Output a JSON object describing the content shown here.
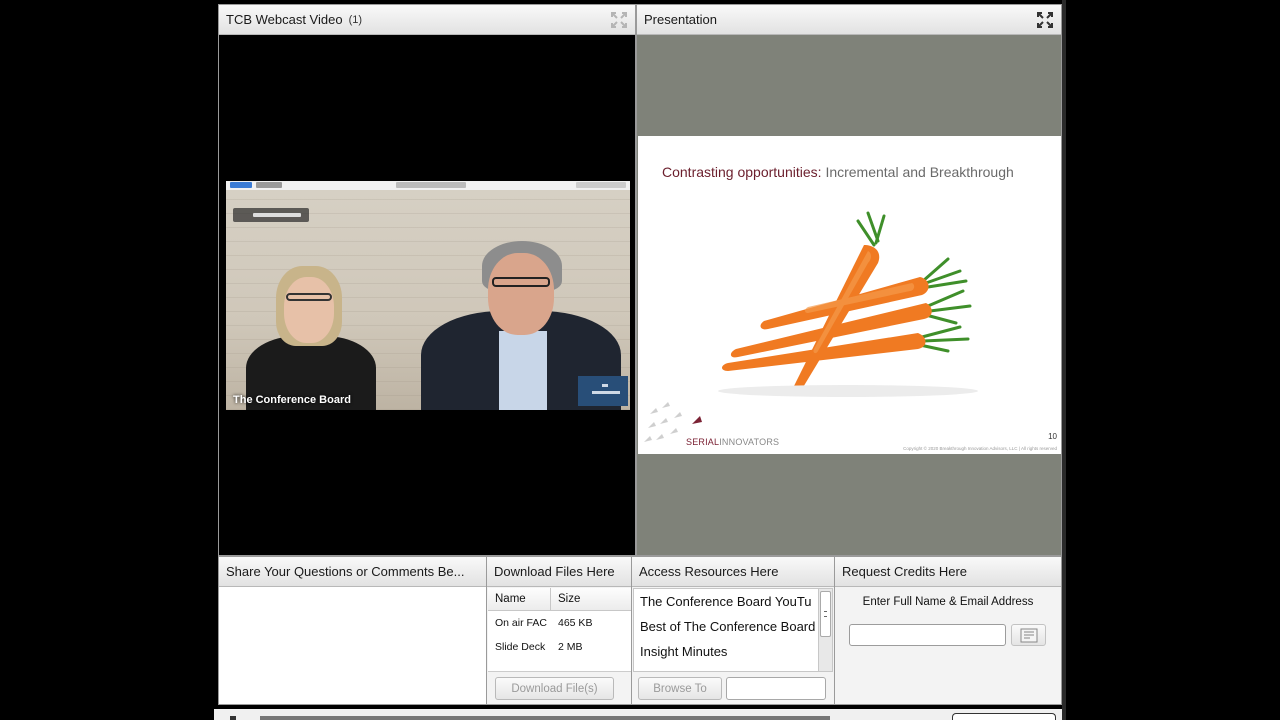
{
  "video_pod": {
    "title": "TCB Webcast Video",
    "count": "(1)",
    "video_label": "The Conference Board"
  },
  "presentation_pod": {
    "title": "Presentation",
    "slide": {
      "title_a": "Contrasting opportunities: ",
      "title_b": "Incremental and Breakthrough",
      "brand_a": "SERIAL",
      "brand_b": "INNOVATORS",
      "number": "10",
      "copyright": "Copyright © 2020 Breakthrough Innovation Advisors, LLC | All rights reserved"
    }
  },
  "questions_pod": {
    "title": "Share Your Questions or Comments Be..."
  },
  "files_pod": {
    "title": "Download Files Here",
    "columns": [
      "Name",
      "Size"
    ],
    "rows": [
      {
        "name": "On air FAC",
        "size": "465 KB"
      },
      {
        "name": "Slide Deck",
        "size": "2 MB"
      }
    ],
    "download_label": "Download File(s)"
  },
  "resources_pod": {
    "title": "Access Resources Here",
    "items": [
      "The Conference Board YouTu",
      "Best of The Conference Board",
      "Insight Minutes"
    ],
    "browse_label": "Browse To",
    "url_value": ""
  },
  "credits_pod": {
    "title": "Request Credits Here",
    "label": "Enter Full Name & Email Address",
    "input_value": ""
  }
}
